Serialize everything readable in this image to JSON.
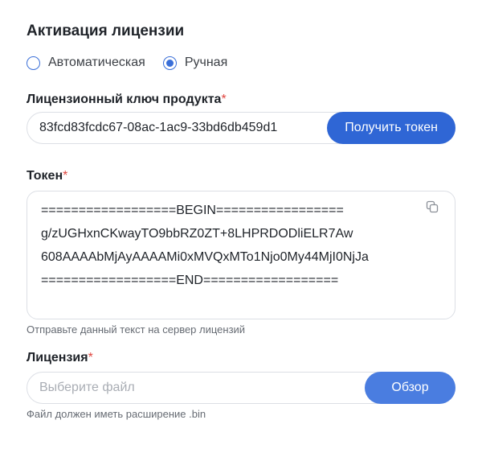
{
  "section": {
    "title": "Активация лицензии"
  },
  "activation_mode": {
    "options": [
      {
        "label": "Автоматическая",
        "selected": false
      },
      {
        "label": "Ручная",
        "selected": true
      }
    ]
  },
  "product_key": {
    "label": "Лицензионный ключ продукта",
    "required_mark": "*",
    "value": "83fcd83fcdc67-08ac-1ac9-33bd6db459d1",
    "button_label": "Получить токен"
  },
  "token": {
    "label": "Токен",
    "required_mark": "*",
    "lines": [
      "==================BEGIN=================",
      "g/zUGHxnCKwayTO9bbRZ0ZT+8LHPRDODliELR7Aw",
      "608AAAAbMjAyAAAAMi0xMVQxMTo1Njo0My44MjI0NjJa",
      "==================END=================="
    ],
    "copy_icon": "copy-icon",
    "hint": "Отправьте данный текст на сервер лицензий"
  },
  "license": {
    "label": "Лицензия",
    "required_mark": "*",
    "placeholder": "Выберите файл",
    "button_label": "Обзор",
    "hint": "Файл должен иметь расширение .bin"
  },
  "colors": {
    "accent": "#2f66d5",
    "required": "#e0453f",
    "border": "#dcdfe5"
  }
}
